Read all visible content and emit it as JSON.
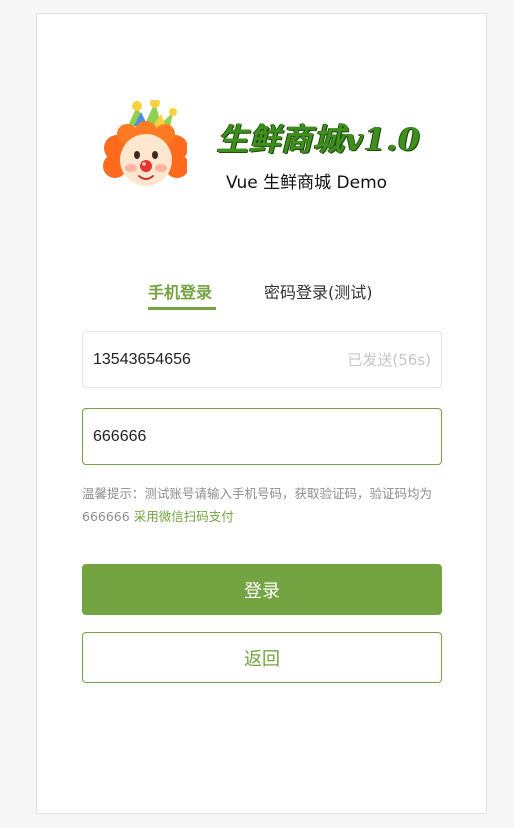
{
  "brand": {
    "script_title": "生鲜商城v1.0",
    "subtitle": "Vue 生鲜商城 Demo"
  },
  "tabs": {
    "phone_login": "手机登录",
    "password_login": "密码登录(测试)"
  },
  "form": {
    "phone_value": "13543654656",
    "send_code_label": "已发送(56s)",
    "code_value": "666666"
  },
  "hint": {
    "text": "温馨提示：测试账号请输入手机号码，获取验证码，验证码均为666666",
    "link": "采用微信扫码支付"
  },
  "buttons": {
    "login": "登录",
    "back": "返回"
  },
  "colors": {
    "accent": "#74a341",
    "brand_green": "#3e8f1d",
    "muted": "#8e8e8e",
    "disabled": "#c6c6c6"
  },
  "icons": {
    "logo": "clown-mascot-icon"
  }
}
